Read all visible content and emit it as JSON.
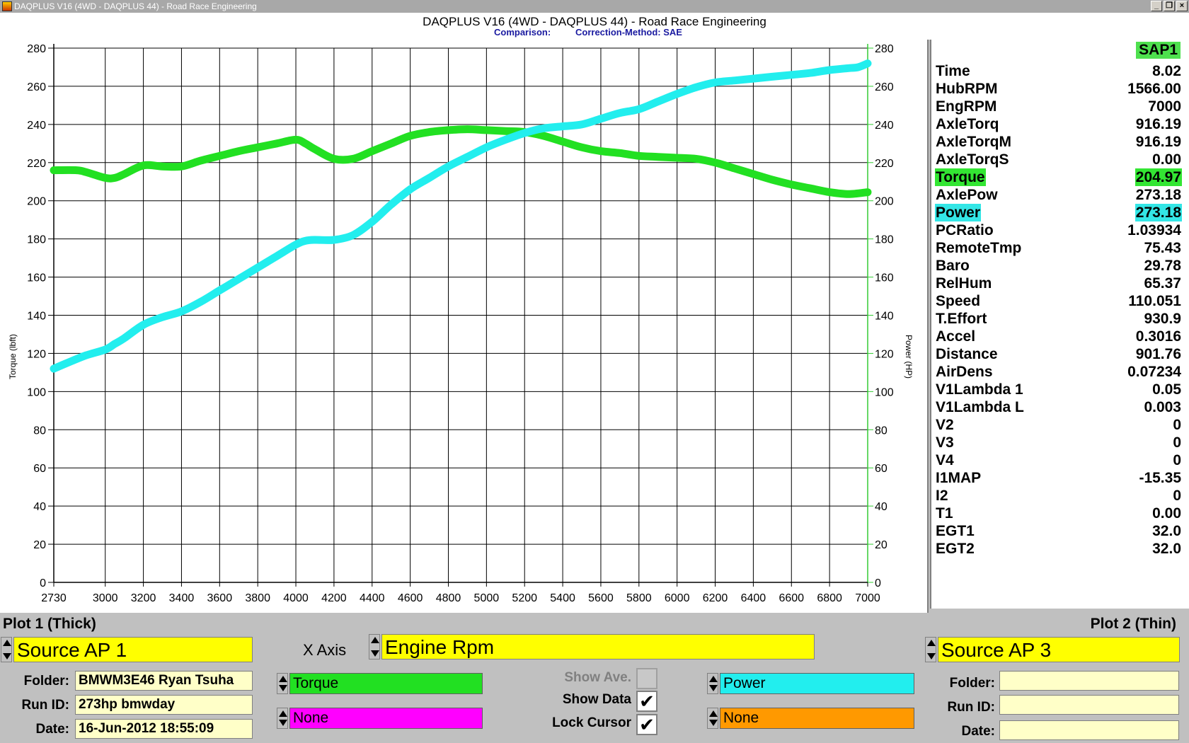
{
  "window": {
    "title": "DAQPLUS V16 (4WD - DAQPLUS 44) - Road Race Engineering"
  },
  "header": {
    "title": "DAQPLUS V16 (4WD - DAQPLUS 44) - Road Race Engineering",
    "comparison": "Comparison:",
    "correction": "Correction-Method: SAE"
  },
  "chart_data": {
    "type": "line",
    "xlabel": "",
    "ylabel": "Torque (lbft)",
    "y2label": "Power (HP)",
    "xlim": [
      2730,
      7000
    ],
    "ylim": [
      0,
      280
    ],
    "y2lim": [
      0,
      280
    ],
    "grid": true,
    "x_ticks": [
      2730,
      3000,
      3200,
      3400,
      3600,
      3800,
      4000,
      4200,
      4400,
      4600,
      4800,
      5000,
      5200,
      5400,
      5600,
      5800,
      6000,
      6200,
      6400,
      6600,
      6800,
      7000
    ],
    "y_ticks": [
      0,
      20,
      40,
      60,
      80,
      100,
      120,
      140,
      160,
      180,
      200,
      220,
      240,
      260,
      280
    ],
    "series": [
      {
        "color": "#22e022",
        "x": [
          2730,
          2850,
          2900,
          3000,
          3050,
          3100,
          3200,
          3300,
          3400,
          3500,
          3600,
          3700,
          3800,
          3900,
          4000,
          4050,
          4100,
          4200,
          4300,
          4400,
          4500,
          4600,
          4700,
          4800,
          4900,
          5000,
          5100,
          5200,
          5300,
          5400,
          5500,
          5600,
          5700,
          5800,
          5900,
          6000,
          6100,
          6200,
          6300,
          6400,
          6500,
          6600,
          6700,
          6800,
          6900,
          7000
        ],
        "y": [
          216,
          216,
          215,
          212,
          212,
          214,
          218.5,
          218,
          218,
          221,
          223.5,
          226,
          228,
          230,
          232,
          230,
          227,
          222,
          222,
          226,
          230,
          234,
          236,
          237,
          237.5,
          237,
          236.5,
          236,
          234,
          231,
          228,
          226,
          225,
          223.5,
          223,
          222.5,
          222,
          220,
          217,
          214,
          211,
          208.5,
          206.5,
          204.5,
          203.5,
          204.5
        ]
      },
      {
        "color": "#22eeee",
        "x": [
          2730,
          2800,
          2900,
          3000,
          3050,
          3100,
          3200,
          3300,
          3400,
          3500,
          3600,
          3700,
          3800,
          3900,
          4000,
          4050,
          4100,
          4200,
          4300,
          4400,
          4500,
          4600,
          4700,
          4800,
          4900,
          5000,
          5100,
          5200,
          5300,
          5400,
          5500,
          5600,
          5700,
          5800,
          5900,
          6000,
          6100,
          6200,
          6300,
          6400,
          6500,
          6600,
          6700,
          6800,
          6900,
          6950,
          7000
        ],
        "y": [
          112,
          115,
          119,
          122,
          125,
          128,
          135,
          139,
          142,
          147,
          153,
          159,
          165,
          171,
          177,
          179,
          179.5,
          179.5,
          182,
          189,
          198,
          206,
          212,
          218,
          223,
          228,
          232,
          235.5,
          238,
          239,
          240,
          243,
          246,
          248,
          252,
          256,
          259.5,
          262,
          263,
          264,
          265,
          266,
          267,
          268.5,
          269.5,
          270,
          272
        ]
      }
    ]
  },
  "data_panel": {
    "header": "SAP1",
    "rows": [
      {
        "label": "Time",
        "value": "8.02"
      },
      {
        "label": "HubRPM",
        "value": "1566.00"
      },
      {
        "label": "EngRPM",
        "value": "7000"
      },
      {
        "label": "AxleTorq",
        "value": "916.19"
      },
      {
        "label": "AxleTorqM",
        "value": "916.19"
      },
      {
        "label": "AxleTorqS",
        "value": "0.00"
      },
      {
        "label": "Torque",
        "value": "204.97",
        "highlight": "green"
      },
      {
        "label": "AxlePow",
        "value": "273.18"
      },
      {
        "label": "Power",
        "value": "273.18",
        "highlight": "cyan"
      },
      {
        "label": "PCRatio",
        "value": "1.03934"
      },
      {
        "label": "RemoteTmp",
        "value": "75.43"
      },
      {
        "label": "Baro",
        "value": "29.78"
      },
      {
        "label": "RelHum",
        "value": "65.37"
      },
      {
        "label": "Speed",
        "value": "110.051"
      },
      {
        "label": "T.Effort",
        "value": "930.9"
      },
      {
        "label": "Accel",
        "value": "0.3016"
      },
      {
        "label": "Distance",
        "value": "901.76"
      },
      {
        "label": "AirDens",
        "value": "0.07234"
      },
      {
        "label": "V1Lambda 1",
        "value": "0.05"
      },
      {
        "label": "V1Lambda L",
        "value": "0.003"
      },
      {
        "label": "V2",
        "value": "0"
      },
      {
        "label": "V3",
        "value": "0"
      },
      {
        "label": "V4",
        "value": "0"
      },
      {
        "label": "I1MAP",
        "value": "-15.35"
      },
      {
        "label": "I2",
        "value": "0"
      },
      {
        "label": "T1",
        "value": "0.00"
      },
      {
        "label": "EGT1",
        "value": "32.0"
      },
      {
        "label": "EGT2",
        "value": "32.0"
      }
    ]
  },
  "bottom": {
    "plot1_title": "Plot 1 (Thick)",
    "plot2_title": "Plot 2 (Thin)",
    "source1": "Source AP 1",
    "source2": "Source AP 3",
    "x_axis_label": "X Axis",
    "x_axis_value": "Engine Rpm",
    "folder_label": "Folder:",
    "runid_label": "Run ID:",
    "date_label": "Date:",
    "folder1": "BMWM3E46 Ryan Tsuha",
    "runid1": "273hp bmwday",
    "date1": "16-Jun-2012  18:55:09",
    "folder2": "",
    "runid2": "",
    "date2": "",
    "channel1a": "Torque",
    "channel1b": "None",
    "channel2a": "Power",
    "channel2b": "None",
    "channel1a_color": "#22e022",
    "channel1b_color": "#ff00ff",
    "channel2a_color": "#22eeee",
    "channel2b_color": "#ff9900",
    "show_ave": "Show Ave.",
    "show_data": "Show Data",
    "lock_cursor": "Lock Cursor",
    "show_ave_checked": false,
    "show_data_checked": true,
    "lock_cursor_checked": true
  }
}
